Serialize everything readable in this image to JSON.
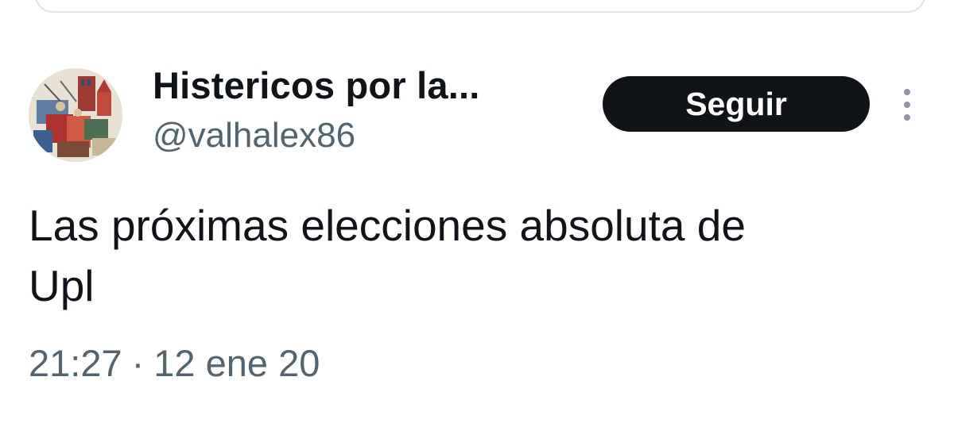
{
  "tweet": {
    "author": {
      "display_name": "Histericos por la...",
      "handle": "@valhalex86",
      "avatar_icon": "painting-avatar"
    },
    "follow_label": "Seguir",
    "more_icon": "more-vertical-icon",
    "text_line1": "Las próximas elecciones absoluta de",
    "text_line2": "Upl",
    "time": "21:27",
    "separator": "·",
    "date": "12 ene 20"
  },
  "colors": {
    "text_primary": "#0f1419",
    "text_secondary": "#536471",
    "button_bg": "#0f1419",
    "button_text": "#ffffff"
  }
}
